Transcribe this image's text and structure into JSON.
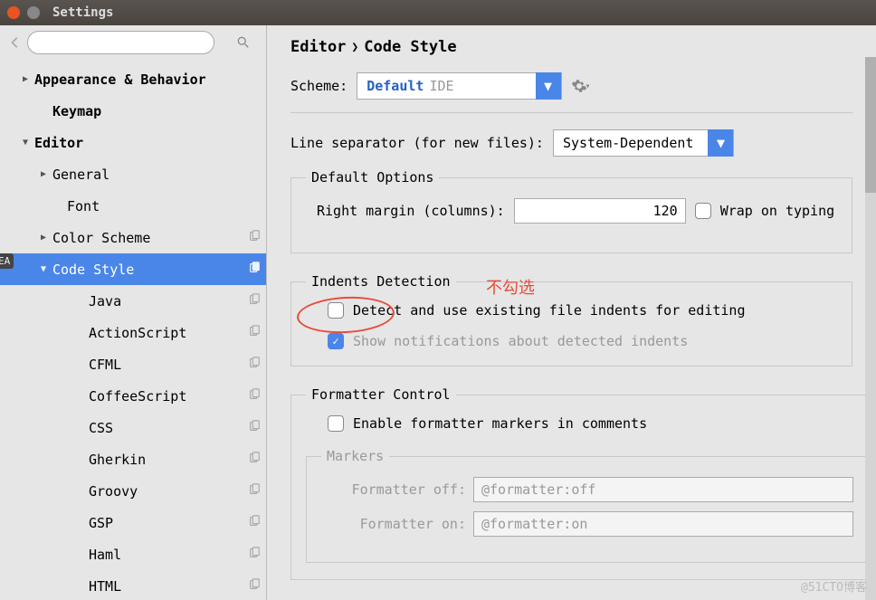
{
  "window": {
    "title": "Settings"
  },
  "breadcrumb": {
    "parent": "Editor",
    "child": "Code Style"
  },
  "sidebar": {
    "items": [
      {
        "label": "Appearance & Behavior",
        "level": 0,
        "arrow": "▶",
        "bold": true,
        "copy": false
      },
      {
        "label": "Keymap",
        "level": 1,
        "arrow": "",
        "bold": true,
        "copy": false
      },
      {
        "label": "Editor",
        "level": 0,
        "arrow": "▼",
        "bold": true,
        "copy": false
      },
      {
        "label": "General",
        "level": 1,
        "arrow": "▶",
        "bold": false,
        "copy": false
      },
      {
        "label": "Font",
        "level": 2,
        "arrow": "",
        "bold": false,
        "copy": false
      },
      {
        "label": "Color Scheme",
        "level": 1,
        "arrow": "▶",
        "bold": false,
        "copy": true
      },
      {
        "label": "Code Style",
        "level": 1,
        "arrow": "▼",
        "bold": false,
        "copy": true,
        "selected": true
      },
      {
        "label": "Java",
        "level": 3,
        "arrow": "",
        "bold": false,
        "copy": true
      },
      {
        "label": "ActionScript",
        "level": 3,
        "arrow": "",
        "bold": false,
        "copy": true
      },
      {
        "label": "CFML",
        "level": 3,
        "arrow": "",
        "bold": false,
        "copy": true
      },
      {
        "label": "CoffeeScript",
        "level": 3,
        "arrow": "",
        "bold": false,
        "copy": true
      },
      {
        "label": "CSS",
        "level": 3,
        "arrow": "",
        "bold": false,
        "copy": true
      },
      {
        "label": "Gherkin",
        "level": 3,
        "arrow": "",
        "bold": false,
        "copy": true
      },
      {
        "label": "Groovy",
        "level": 3,
        "arrow": "",
        "bold": false,
        "copy": true
      },
      {
        "label": "GSP",
        "level": 3,
        "arrow": "",
        "bold": false,
        "copy": true
      },
      {
        "label": "Haml",
        "level": 3,
        "arrow": "",
        "bold": false,
        "copy": true
      },
      {
        "label": "HTML",
        "level": 3,
        "arrow": "",
        "bold": false,
        "copy": true
      }
    ]
  },
  "scheme": {
    "label": "Scheme:",
    "value": "Default",
    "suffix": "IDE"
  },
  "line_sep": {
    "label": "Line separator (for new files):",
    "value": "System-Dependent"
  },
  "default_opts": {
    "legend": "Default Options",
    "margin_label": "Right margin (columns):",
    "margin_value": "120",
    "wrap_label": "Wrap on typing"
  },
  "indents": {
    "legend": "Indents Detection",
    "detect_label": "Detect and use existing file indents for editing",
    "notify_label": "Show notifications about detected indents"
  },
  "formatter": {
    "legend": "Formatter Control",
    "enable_label": "Enable formatter markers in comments",
    "markers_legend": "Markers",
    "off_label": "Formatter off:",
    "off_value": "@formatter:off",
    "on_label": "Formatter on:",
    "on_value": "@formatter:on"
  },
  "annotation": {
    "text": "不勾选"
  },
  "ea_tag": "EA",
  "watermark": "@51CTO博客"
}
